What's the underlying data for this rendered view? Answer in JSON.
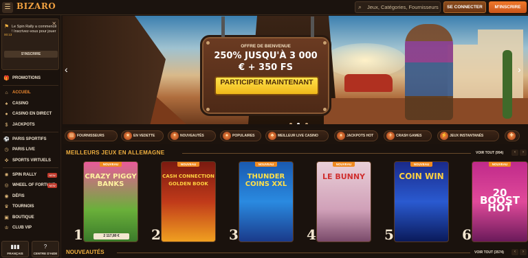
{
  "header": {
    "logo": "BIZARO",
    "search_placeholder": "Jeux, Catégories, Fournisseurs",
    "login_label": "SE CONNECTER",
    "signup_label": "M'INSCRIRE"
  },
  "sidebar": {
    "promo": {
      "text": "Le Spin Rally a commencé ! Inscrivez-vous pour jouer",
      "time": "00:13",
      "cta": "S'INSCRIRE"
    },
    "items": [
      {
        "label": "PROMOTIONS",
        "icon": "gift-icon",
        "active": false,
        "new": false
      },
      {
        "label": "ACCUEIL",
        "icon": "home-icon",
        "active": true,
        "new": false
      },
      {
        "label": "CASINO",
        "icon": "cards-icon",
        "active": false,
        "new": false
      },
      {
        "label": "CASINO EN DIRECT",
        "icon": "live-icon",
        "active": false,
        "new": false
      },
      {
        "label": "JACKPOTS",
        "icon": "jackpot-icon",
        "active": false,
        "new": false
      },
      {
        "label": "PARIS SPORTIFS",
        "icon": "ball-icon",
        "active": false,
        "new": false
      },
      {
        "label": "PARIS LIVE",
        "icon": "stopwatch-icon",
        "active": false,
        "new": false
      },
      {
        "label": "SPORTS VIRTUELS",
        "icon": "joystick-icon",
        "active": false,
        "new": false
      },
      {
        "label": "SPIN RALLY",
        "icon": "wheel-icon",
        "active": false,
        "new": true
      },
      {
        "label": "WHEEL OF FORTUNE",
        "icon": "fortune-icon",
        "active": false,
        "new": true
      },
      {
        "label": "DÉFIS",
        "icon": "target-icon",
        "active": false,
        "new": false
      },
      {
        "label": "TOURNOIS",
        "icon": "trophy-icon",
        "active": false,
        "new": false
      },
      {
        "label": "BOUTIQUE",
        "icon": "shop-icon",
        "active": false,
        "new": false
      },
      {
        "label": "CLUB VIP",
        "icon": "crown-icon",
        "active": false,
        "new": false
      }
    ],
    "new_badge": "NEW",
    "lang_label": "FRANÇAIS",
    "help_label": "CENTRE D'AIDE"
  },
  "hero": {
    "sign_head": "OFFRE DE BIENVENUE",
    "line1": "250% JUSQU'À 3 000",
    "line2": "€ + 350 FS",
    "cta": "PARTICIPER MAINTENANT"
  },
  "categories": [
    "FOURNISSEURS",
    "EN VEDETTE",
    "NOUVEAUTÉS",
    "POPULAIRES",
    "MEILLEUR LIVE CASINO",
    "JACKPOTS HOT",
    "CRASH GAMES",
    "JEUX INSTANTANÉS"
  ],
  "best": {
    "title": "MEILLEURS JEUX EN ALLEMAGNE",
    "see_all": "VOIR TOUT (994)",
    "badge": "NOUVEAU",
    "games": [
      {
        "title": "CRAZY PIGGY BANKS",
        "rank": "1",
        "prize": "2 117,80 €"
      },
      {
        "title": "CASH CONNECTION GOLDEN BOOK",
        "rank": "2",
        "prize": ""
      },
      {
        "title": "THUNDER COINS XXL",
        "rank": "3",
        "prize": ""
      },
      {
        "title": "LE BUNNY",
        "rank": "4",
        "prize": ""
      },
      {
        "title": "COIN WIN",
        "rank": "5",
        "prize": ""
      },
      {
        "title": "20 BOOST HOT",
        "rank": "6",
        "prize": ""
      }
    ]
  },
  "new_section": {
    "title": "NOUVEAUTÉS",
    "see_all": "VOIR TOUT (3574)"
  }
}
